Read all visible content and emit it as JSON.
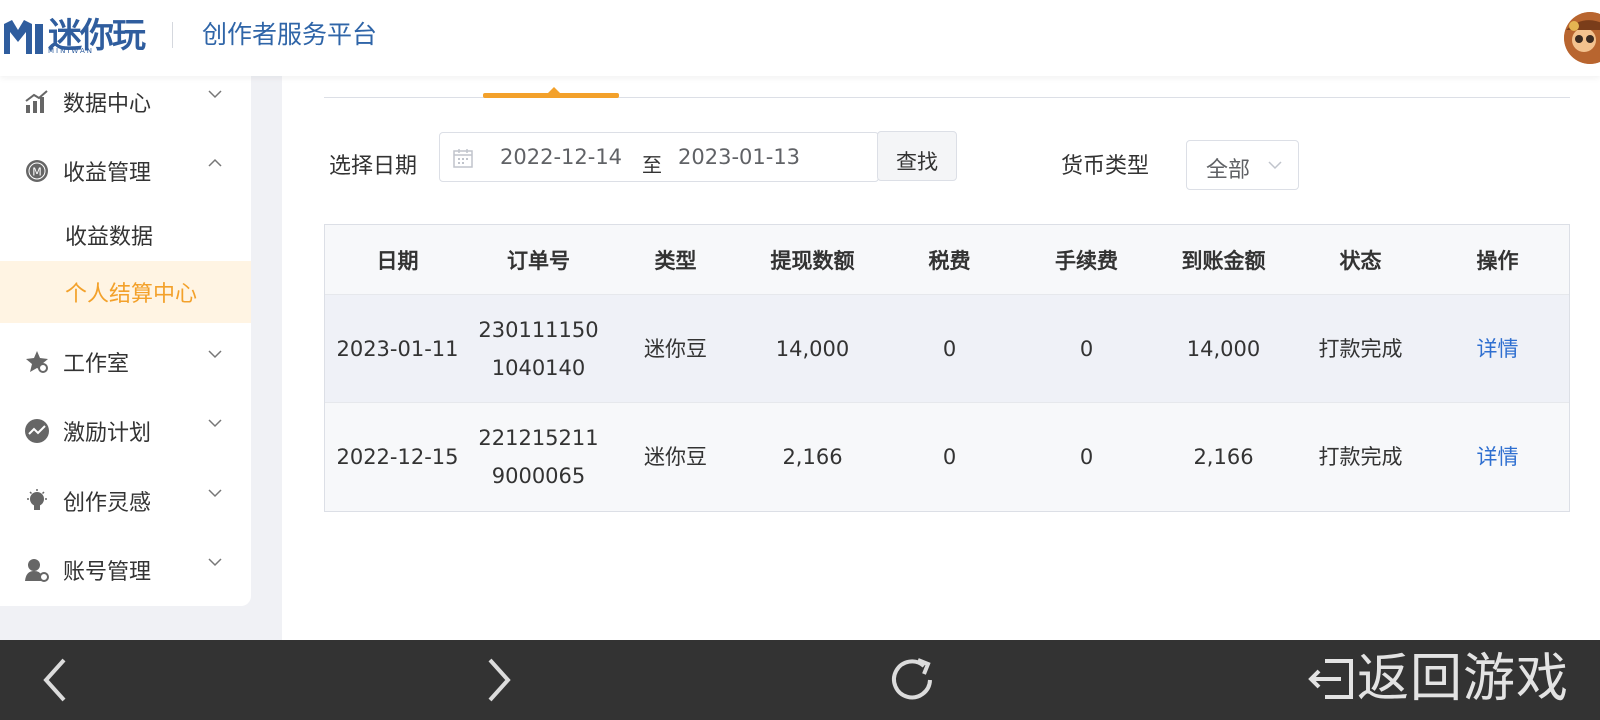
{
  "header": {
    "logo_text": "迷你玩",
    "logo_sub": "MINIWAN",
    "title": "创作者服务平台"
  },
  "sidebar": {
    "items": [
      {
        "label": "数据中心",
        "icon": "chart-bars-icon",
        "expanded": false
      },
      {
        "label": "收益管理",
        "icon": "coin-m-icon",
        "expanded": true
      },
      {
        "label": "工作室",
        "icon": "star-gear-icon",
        "expanded": false
      },
      {
        "label": "激励计划",
        "icon": "trend-circle-icon",
        "expanded": false
      },
      {
        "label": "创作灵感",
        "icon": "lightbulb-icon",
        "expanded": false
      },
      {
        "label": "账号管理",
        "icon": "user-gear-icon",
        "expanded": false
      }
    ],
    "sub_items": [
      {
        "label": "收益数据",
        "active": false
      },
      {
        "label": "个人结算中心",
        "active": true
      }
    ]
  },
  "filters": {
    "date_label": "选择日期",
    "start_date": "2022-12-14",
    "separator": "至",
    "end_date": "2023-01-13",
    "find_button": "查找",
    "currency_label": "货币类型",
    "currency_value": "全部"
  },
  "table": {
    "headers": [
      "日期",
      "订单号",
      "类型",
      "提现数额",
      "税费",
      "手续费",
      "到账金额",
      "状态",
      "操作"
    ],
    "rows": [
      [
        "2023-01-11",
        "2301111501040140",
        "迷你豆",
        "14,000",
        "0",
        "0",
        "14,000",
        "打款完成",
        "详情"
      ],
      [
        "2022-12-15",
        "2212152119000065",
        "迷你豆",
        "2,166",
        "0",
        "0",
        "2,166",
        "打款完成",
        "详情"
      ]
    ]
  },
  "bottom_bar": {
    "back_game_label": "返回游戏"
  },
  "colors": {
    "accent": "#f3a12b",
    "brand": "#2f65a8",
    "link": "#2f6fd0",
    "bottom_bar": "#333333"
  }
}
